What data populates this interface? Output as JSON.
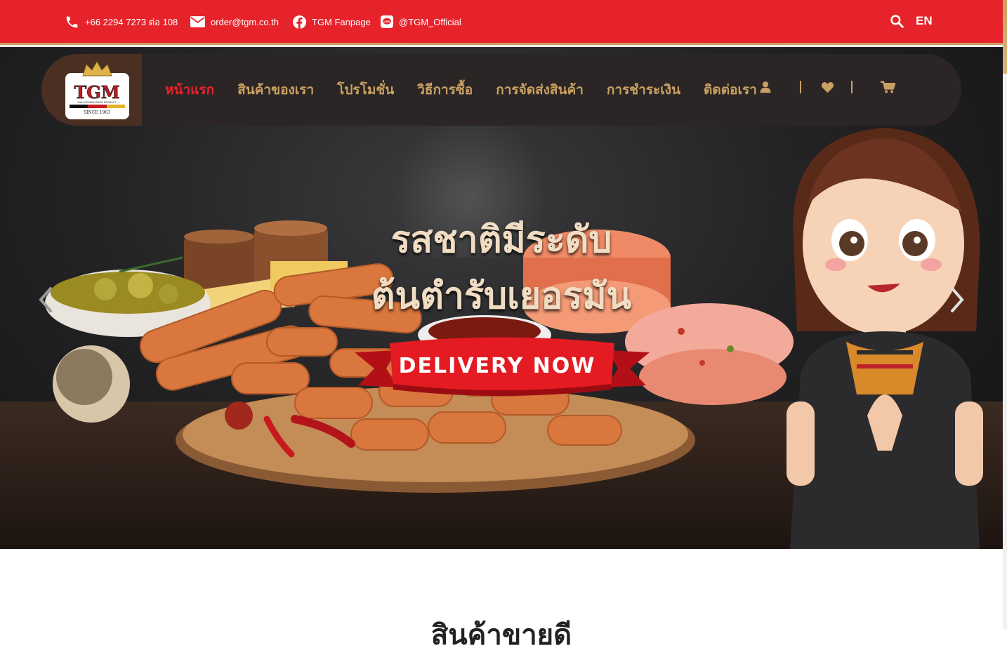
{
  "topbar": {
    "phone": "+66 2294 7273 ต่อ 108",
    "email": "order@tgm.co.th",
    "facebook": "TGM Fanpage",
    "line": "@TGM_Official",
    "lang": "EN"
  },
  "brand": {
    "logo_text": "TGM",
    "logo_tagline": "THAI-GERMAN MEAT PRODUCT",
    "logo_since": "SINCE 1963"
  },
  "nav": {
    "items": [
      {
        "label": "หน้าแรก",
        "active": true
      },
      {
        "label": "สินค้าของเรา",
        "active": false
      },
      {
        "label": "โปรโมชั่น",
        "active": false
      },
      {
        "label": "วิธีการซื้อ",
        "active": false
      },
      {
        "label": "การจัดส่งสินค้า",
        "active": false
      },
      {
        "label": "การชำระเงิน",
        "active": false
      },
      {
        "label": "ติดต่อเรา",
        "active": false
      }
    ],
    "icons": [
      "user-icon",
      "heart-icon",
      "cart-icon"
    ]
  },
  "hero": {
    "headline_line1": "รสชาติมีระดับ",
    "headline_line2": "ต้นตำรับเยอรมัน",
    "ribbon": "DELIVERY NOW"
  },
  "section": {
    "title": "สินค้าขายดี"
  },
  "colors": {
    "topbar": "#e6232b",
    "accent_gold": "#c9a063",
    "nav_bg": "#2b2625",
    "active": "#e6232b"
  }
}
